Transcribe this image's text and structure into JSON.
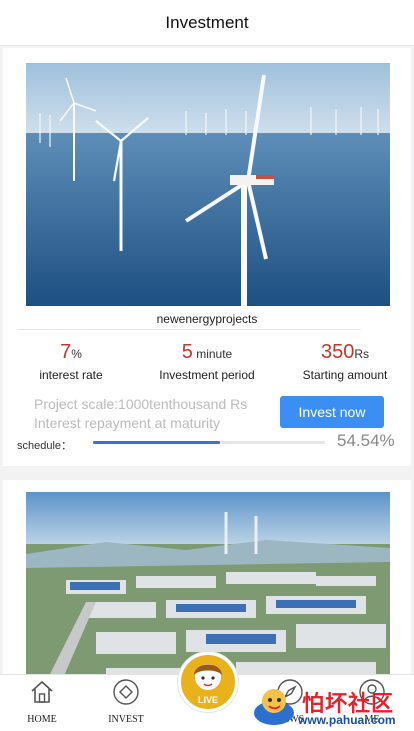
{
  "header": {
    "title": "Investment"
  },
  "products": [
    {
      "name": "newenergyprojects",
      "interest_rate": {
        "value": "7",
        "unit": "%",
        "label": "interest rate"
      },
      "period": {
        "value": "5",
        "unit": " minute",
        "label": "Investment period"
      },
      "starting": {
        "value": "350",
        "unit": "Rs",
        "label": "Starting amount"
      },
      "scale_text": "Project scale:1000tenthousand Rs",
      "repayment_text": "Interest repayment at maturity",
      "button_label": "Invest now",
      "schedule_label": "schedule：",
      "progress_text": "54.54%",
      "progress_fraction": 0.5454
    },
    {
      "image": "industrial-park-aerial-photo"
    }
  ],
  "tabbar": {
    "items": [
      {
        "label": "HOME",
        "icon": "house-icon"
      },
      {
        "label": "INVEST",
        "icon": "diamond-icon"
      },
      {
        "label": "LIVE",
        "icon": "live-avatar-icon"
      },
      {
        "label": "NEWS",
        "icon": "compass-icon"
      },
      {
        "label": "ME",
        "icon": "user-icon"
      }
    ]
  },
  "watermark": {
    "text": "怕坏社区",
    "url": "www.pahuai.com"
  },
  "colors": {
    "accent": "#3b8ff3",
    "value_red": "#c0392b",
    "progress": "#3b73c8",
    "live_gold": "#e9b21c"
  }
}
